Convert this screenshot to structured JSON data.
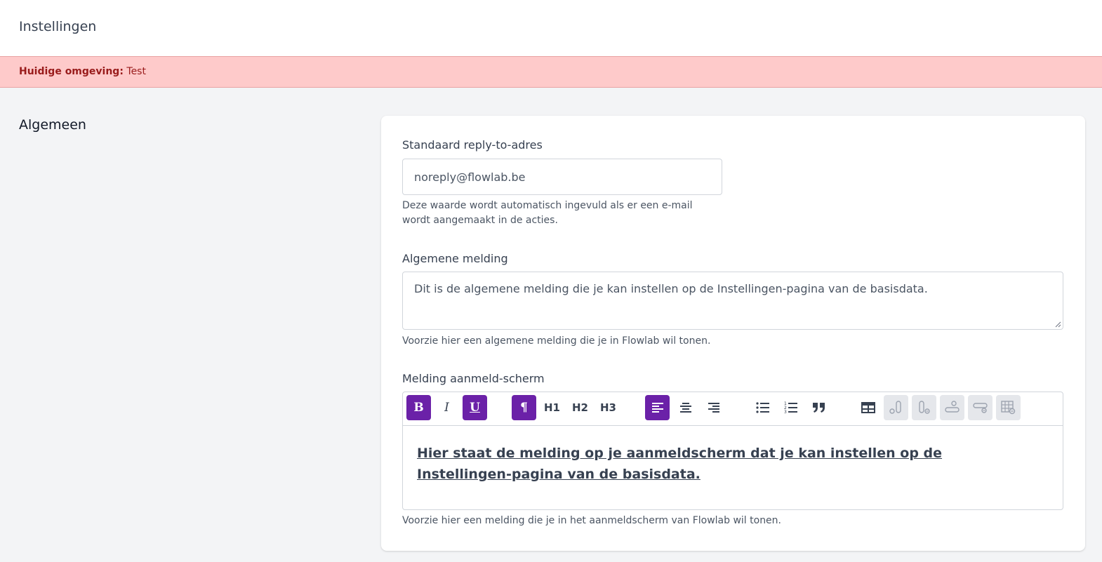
{
  "header": {
    "title": "Instellingen"
  },
  "environment": {
    "label": "Huidige omgeving:",
    "value": "Test"
  },
  "section": {
    "title": "Algemeen"
  },
  "fields": {
    "reply_to": {
      "label": "Standaard reply-to-adres",
      "value": "noreply@flowlab.be",
      "help_line1": "Deze waarde wordt automatisch ingevuld als er een e-mail",
      "help_line2": "wordt aangemaakt in de acties."
    },
    "general_notice": {
      "label": "Algemene melding",
      "value": "Dit is de algemene melding die je kan instellen op de Instellingen-pagina van de basisdata.",
      "help": "Voorzie hier een algemene melding die je in Flowlab wil tonen."
    },
    "login_notice": {
      "label": "Melding aanmeld-scherm",
      "content": "Hier staat de melding op je aanmeldscherm dat je kan instellen op de Instellingen-pagina van de basisdata.",
      "help": "Voorzie hier een melding die je in het aanmeldscherm van Flowlab wil tonen."
    }
  },
  "toolbar": {
    "bold": "B",
    "italic": "I",
    "underline": "U",
    "paragraph": "¶",
    "h1": "H1",
    "h2": "H2",
    "h3": "H3",
    "active_color": "#6b21a8",
    "icons": [
      "bold-icon",
      "italic-icon",
      "underline-icon",
      "paragraph-icon",
      "heading-1-icon",
      "heading-2-icon",
      "heading-3-icon",
      "align-left-icon",
      "align-center-icon",
      "align-right-icon",
      "bullet-list-icon",
      "ordered-list-icon",
      "blockquote-icon",
      "insert-table-icon",
      "add-column-icon",
      "delete-column-icon",
      "add-row-icon",
      "delete-row-icon",
      "delete-table-icon"
    ]
  },
  "colors": {
    "banner_bg": "#fecaca",
    "banner_text": "#991b1b",
    "accent": "#6b21a8"
  }
}
